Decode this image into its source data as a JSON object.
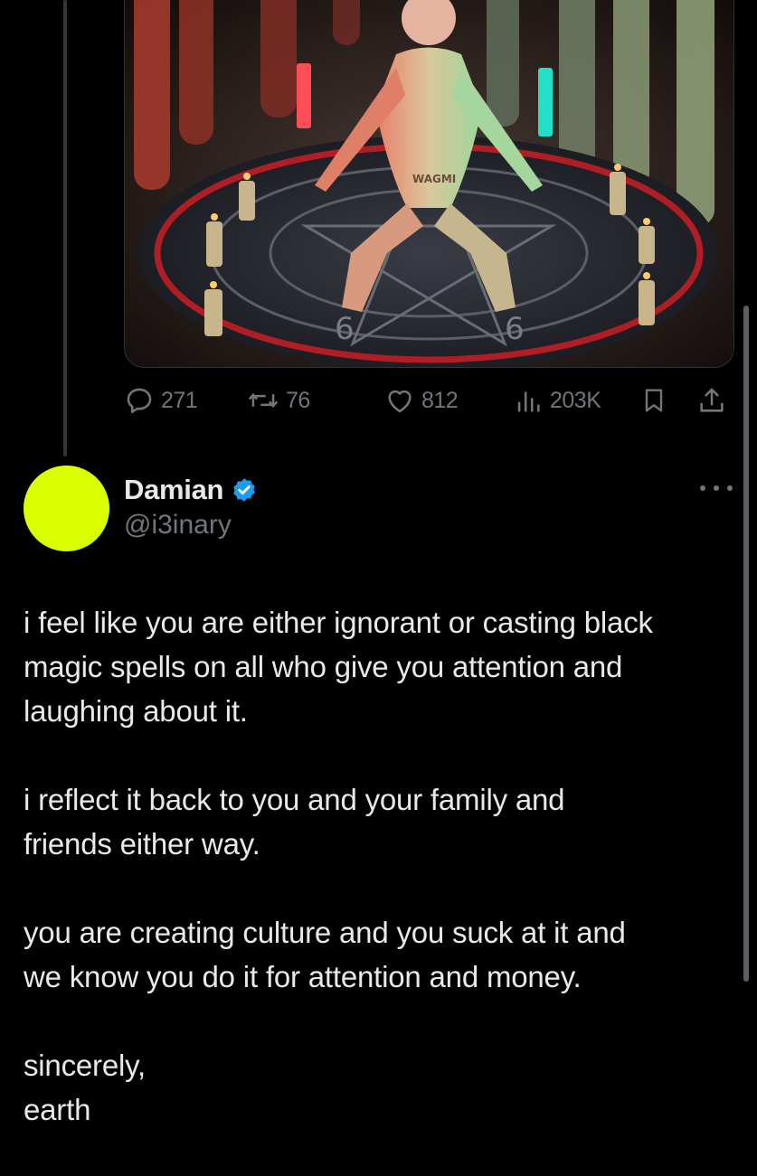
{
  "media": {
    "alt_icon": "ritual-image"
  },
  "actions": {
    "replies": "271",
    "reposts": "76",
    "likes": "812",
    "views": "203K"
  },
  "author": {
    "name": "Damian",
    "handle": "@i3inary",
    "avatar_color": "#d9ff00",
    "verified_color": "#1d9bf0"
  },
  "tweet": {
    "paragraphs": [
      "i feel like you are either ignorant or casting black\nmagic spells on all who give you attention and\nlaughing about it.",
      "i reflect it back to you and your family and\nfriends either way.",
      "you are creating culture and you suck at it and\nwe know you do it for attention and money.",
      "sincerely,\nearth"
    ]
  },
  "image_text": {
    "sign_left": "6",
    "sign_right": "6",
    "body_text": "WAGMI"
  }
}
